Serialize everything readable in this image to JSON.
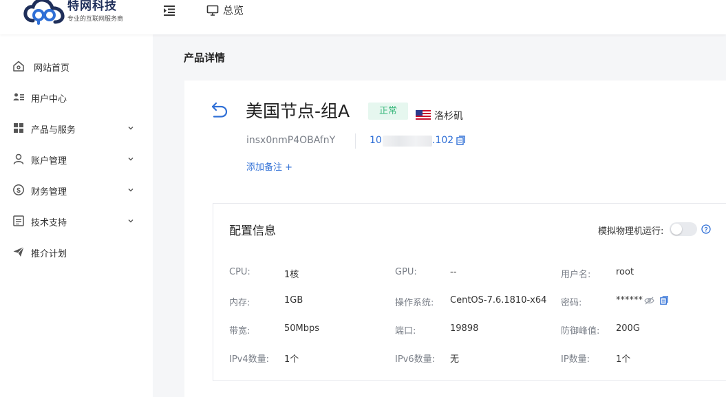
{
  "brand": {
    "name": "特网科技",
    "tagline": "专业的互联网服务商"
  },
  "header": {
    "overview_label": "总览"
  },
  "sidebar": {
    "items": [
      {
        "label": "网站首页",
        "icon": "home-icon",
        "has_children": false
      },
      {
        "label": "用户中心",
        "icon": "user-card-icon",
        "has_children": false
      },
      {
        "label": "产品与服务",
        "icon": "grid-icon",
        "has_children": true
      },
      {
        "label": "账户管理",
        "icon": "person-icon",
        "has_children": true
      },
      {
        "label": "财务管理",
        "icon": "dollar-icon",
        "has_children": true
      },
      {
        "label": "技术支持",
        "icon": "document-icon",
        "has_children": true
      },
      {
        "label": "推介计划",
        "icon": "paper-plane-icon",
        "has_children": false
      }
    ]
  },
  "page": {
    "title": "产品详情"
  },
  "product": {
    "name": "美国节点-组A",
    "status": "正常",
    "location": "洛杉矶",
    "id": "insx0nmP4OBAfnY",
    "ip_prefix": "10",
    "ip_suffix": ".102",
    "add_note": "添加备注 +"
  },
  "config": {
    "title": "配置信息",
    "sim_label": "模拟物理机运行:",
    "sim_enabled": false,
    "specs": [
      {
        "label": "CPU:",
        "value": "1核"
      },
      {
        "label": "GPU:",
        "value": "--"
      },
      {
        "label": "用户名:",
        "value": "root"
      },
      {
        "label": "内存:",
        "value": "1GB"
      },
      {
        "label": "操作系统:",
        "value": "CentOS-7.6.1810-x64"
      },
      {
        "label": "密码:",
        "value": "******"
      },
      {
        "label": "带宽:",
        "value": "50Mbps"
      },
      {
        "label": "端口:",
        "value": "19898"
      },
      {
        "label": "防御峰值:",
        "value": "200G"
      },
      {
        "label": "IPv4数量:",
        "value": "1个"
      },
      {
        "label": "IPv6数量:",
        "value": "无"
      },
      {
        "label": "IP数量:",
        "value": "1个"
      }
    ]
  },
  "colors": {
    "accent": "#2f6fd6",
    "status_bg": "#e6f7ef",
    "status_text": "#3bb87d"
  }
}
